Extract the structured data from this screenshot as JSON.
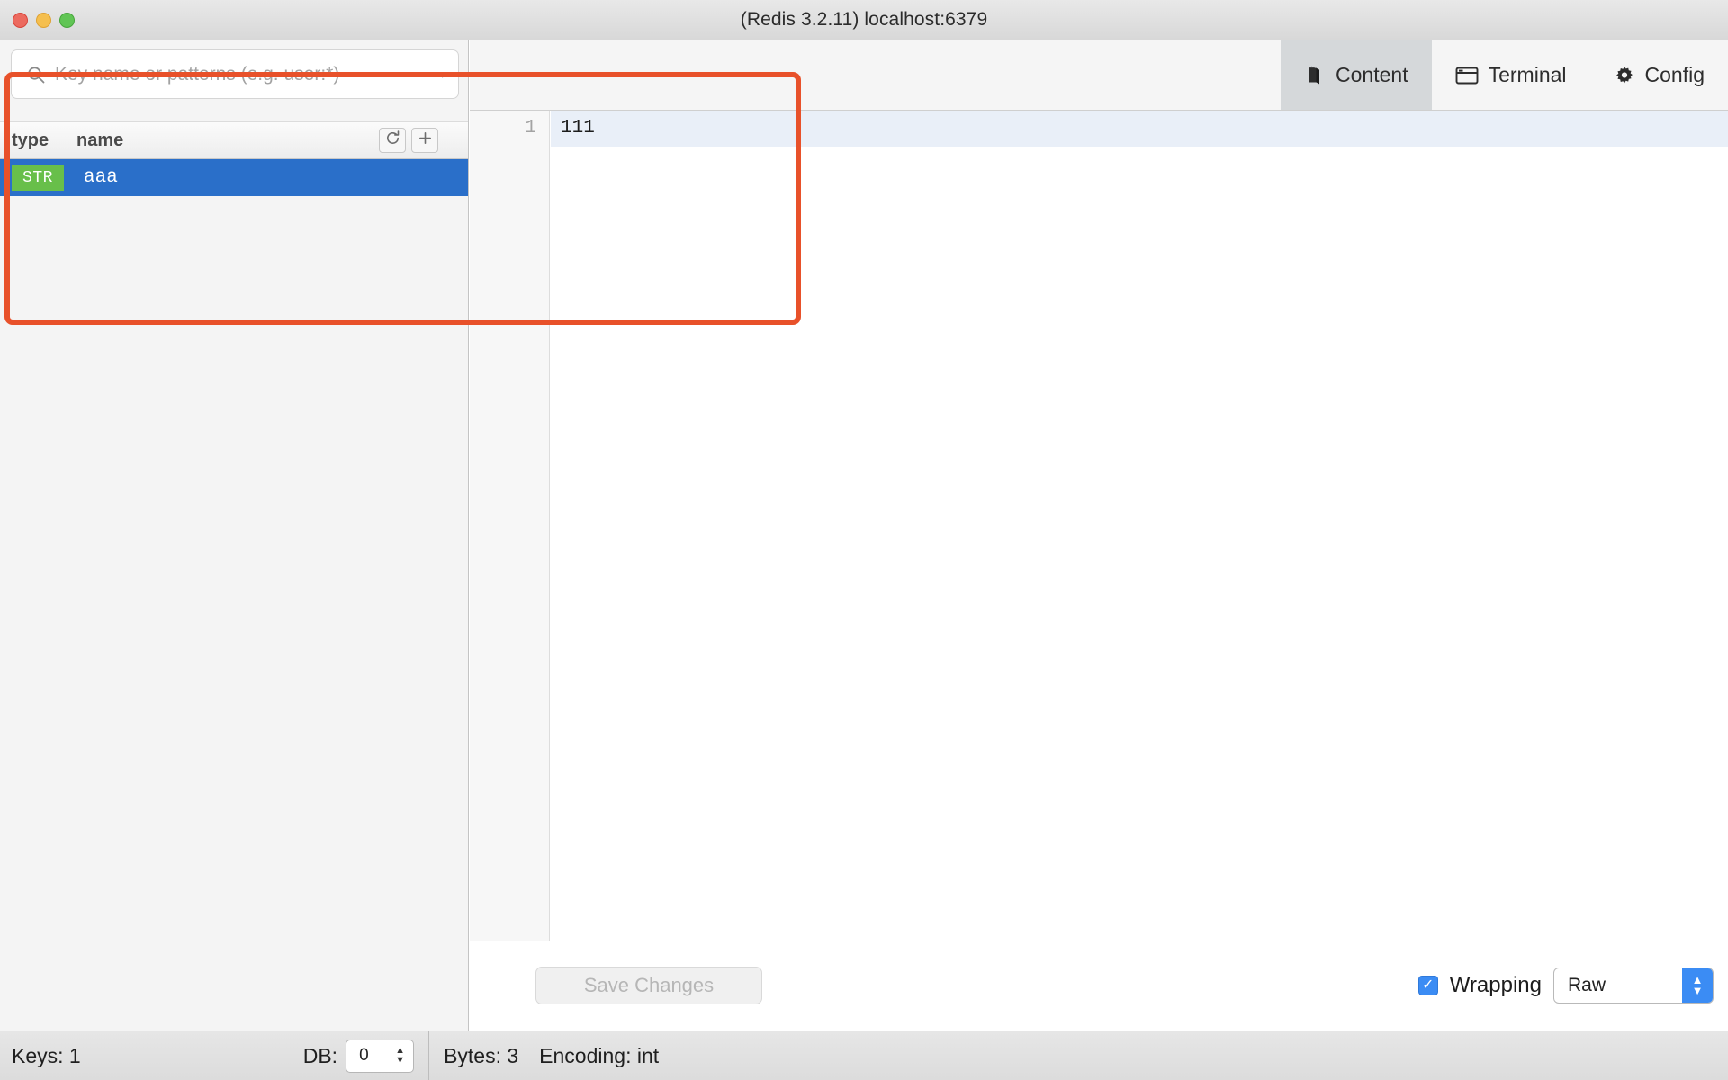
{
  "window": {
    "title": "(Redis 3.2.11) localhost:6379",
    "controls": {
      "close": "close-button",
      "minimize": "minimize-button",
      "maximize": "maximize-button"
    }
  },
  "sidebar": {
    "search": {
      "placeholder": "Key name or patterns (e.g. user:*)",
      "value": "",
      "icon": "search-icon",
      "dropdown_icon": "chevron-down-icon"
    },
    "columns": {
      "type": "type",
      "name": "name"
    },
    "actions": {
      "refresh": "refresh-icon",
      "add": "plus-icon"
    },
    "keys": [
      {
        "type": "STR",
        "name": "aaa",
        "selected": true
      }
    ]
  },
  "tabs": [
    {
      "label": "Content",
      "icon": "book-icon",
      "active": true
    },
    {
      "label": "Terminal",
      "icon": "window-icon",
      "active": false
    },
    {
      "label": "Config",
      "icon": "gear-icon",
      "active": false
    }
  ],
  "editor": {
    "lines": [
      {
        "number": "1",
        "text": "111"
      }
    ],
    "save_label": "Save Changes",
    "save_disabled": true,
    "wrapping_label": "Wrapping",
    "wrapping_checked": true,
    "view_mode": "Raw",
    "view_mode_options": [
      "Raw"
    ]
  },
  "statusbar": {
    "keys": "Keys: 1",
    "db_label": "DB:",
    "db_value": "0",
    "bytes": "Bytes: 3",
    "encoding": "Encoding: int"
  },
  "colors": {
    "accent_selection": "#2a6fc9",
    "type_badge": "#68bf4a",
    "annotation": "#e8512a",
    "control_blue": "#3b8cf4"
  }
}
